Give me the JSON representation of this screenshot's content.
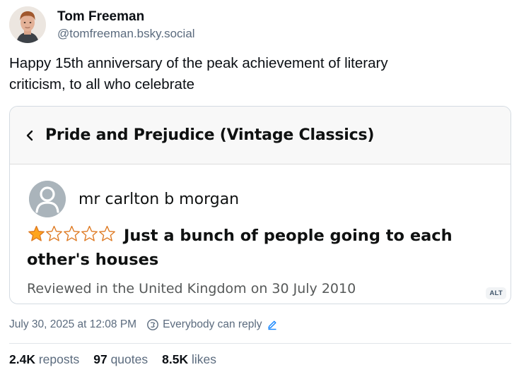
{
  "author": {
    "display_name": "Tom Freeman",
    "handle": "@tomfreeman.bsky.social"
  },
  "post": {
    "text": "Happy 15th anniversary of the peak achievement of literary\ncriticism, to all who celebrate"
  },
  "embed": {
    "book_title": "Pride and Prejudice (Vintage Classics)",
    "reviewer_name": "mr carlton b morgan",
    "rating": 1,
    "rating_max": 5,
    "review_title": "Just a bunch of people going to each other's houses",
    "review_meta": "Reviewed in the United Kingdom on 30 July 2010",
    "alt_badge": "ALT"
  },
  "meta": {
    "timestamp": "July 30, 2025 at 12:08 PM",
    "reply_setting": "Everybody can reply"
  },
  "stats": {
    "reposts_count": "2.4K",
    "reposts_label": "reposts",
    "quotes_count": "97",
    "quotes_label": "quotes",
    "likes_count": "8.5K",
    "likes_label": "likes"
  },
  "colors": {
    "star_fill": "#FFA41C",
    "star_outline": "#DE7921",
    "muted_text": "#5b6b7e",
    "reply_accent": "#1083fe"
  },
  "icons": [
    "avatar-photo",
    "chevron-left-icon",
    "person-placeholder-icon",
    "star-icon",
    "globe-icon",
    "pencil-icon"
  ]
}
